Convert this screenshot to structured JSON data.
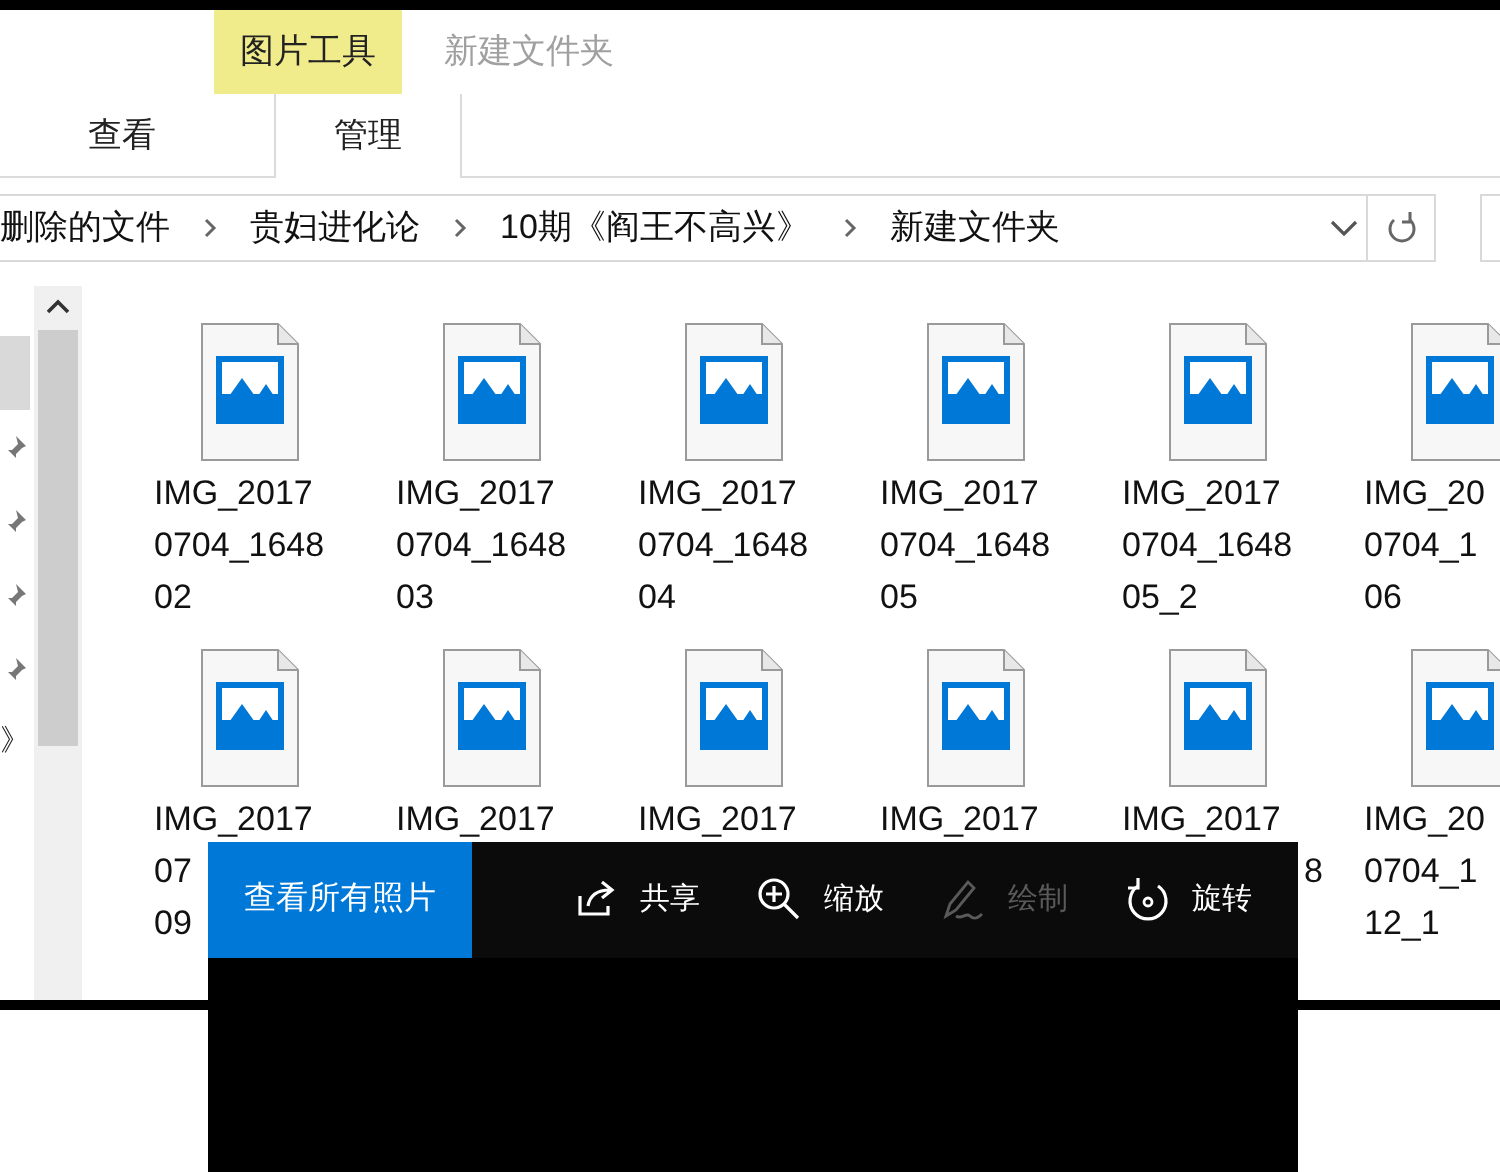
{
  "ribbon": {
    "context_group": "图片工具",
    "title": "新建文件夹",
    "tabs": [
      {
        "label": "查看",
        "selected": false
      },
      {
        "label": "管理",
        "selected": true
      }
    ]
  },
  "address": {
    "crumbs": [
      "删除的文件",
      "贵妇进化论",
      "10期《阎王不高兴》",
      "新建文件夹"
    ]
  },
  "nav": {
    "items": [
      {
        "selected": true,
        "pinned": false
      },
      {
        "selected": false,
        "pinned": true
      },
      {
        "selected": false,
        "pinned": true
      },
      {
        "selected": false,
        "pinned": true
      },
      {
        "selected": false,
        "pinned": true
      },
      {
        "selected": false,
        "pinned": false,
        "label": "》"
      }
    ]
  },
  "files": [
    {
      "lines": [
        "IMG_2017",
        "0704_1648",
        "02"
      ]
    },
    {
      "lines": [
        "IMG_2017",
        "0704_1648",
        "03"
      ]
    },
    {
      "lines": [
        "IMG_2017",
        "0704_1648",
        "04"
      ]
    },
    {
      "lines": [
        "IMG_2017",
        "0704_1648",
        "05"
      ]
    },
    {
      "lines": [
        "IMG_2017",
        "0704_1648",
        "05_2"
      ]
    },
    {
      "lines": [
        "IMG_20",
        "0704_1",
        "06"
      ]
    },
    {
      "lines": [
        "IMG_2017",
        "07",
        "09"
      ]
    },
    {
      "lines": [
        "IMG_2017"
      ]
    },
    {
      "lines": [
        "IMG_2017"
      ]
    },
    {
      "lines": [
        "IMG_2017"
      ]
    },
    {
      "lines": [
        "IMG_2017"
      ],
      "tail": "8"
    },
    {
      "lines": [
        "IMG_20",
        "0704_1",
        "12_1"
      ]
    }
  ],
  "viewer": {
    "all_photos": "查看所有照片",
    "tools": [
      {
        "kind": "share",
        "label": "共享",
        "disabled": false
      },
      {
        "kind": "zoom",
        "label": "缩放",
        "disabled": false
      },
      {
        "kind": "draw",
        "label": "绘制",
        "disabled": true
      },
      {
        "kind": "rotate",
        "label": "旋转",
        "disabled": false
      }
    ]
  }
}
